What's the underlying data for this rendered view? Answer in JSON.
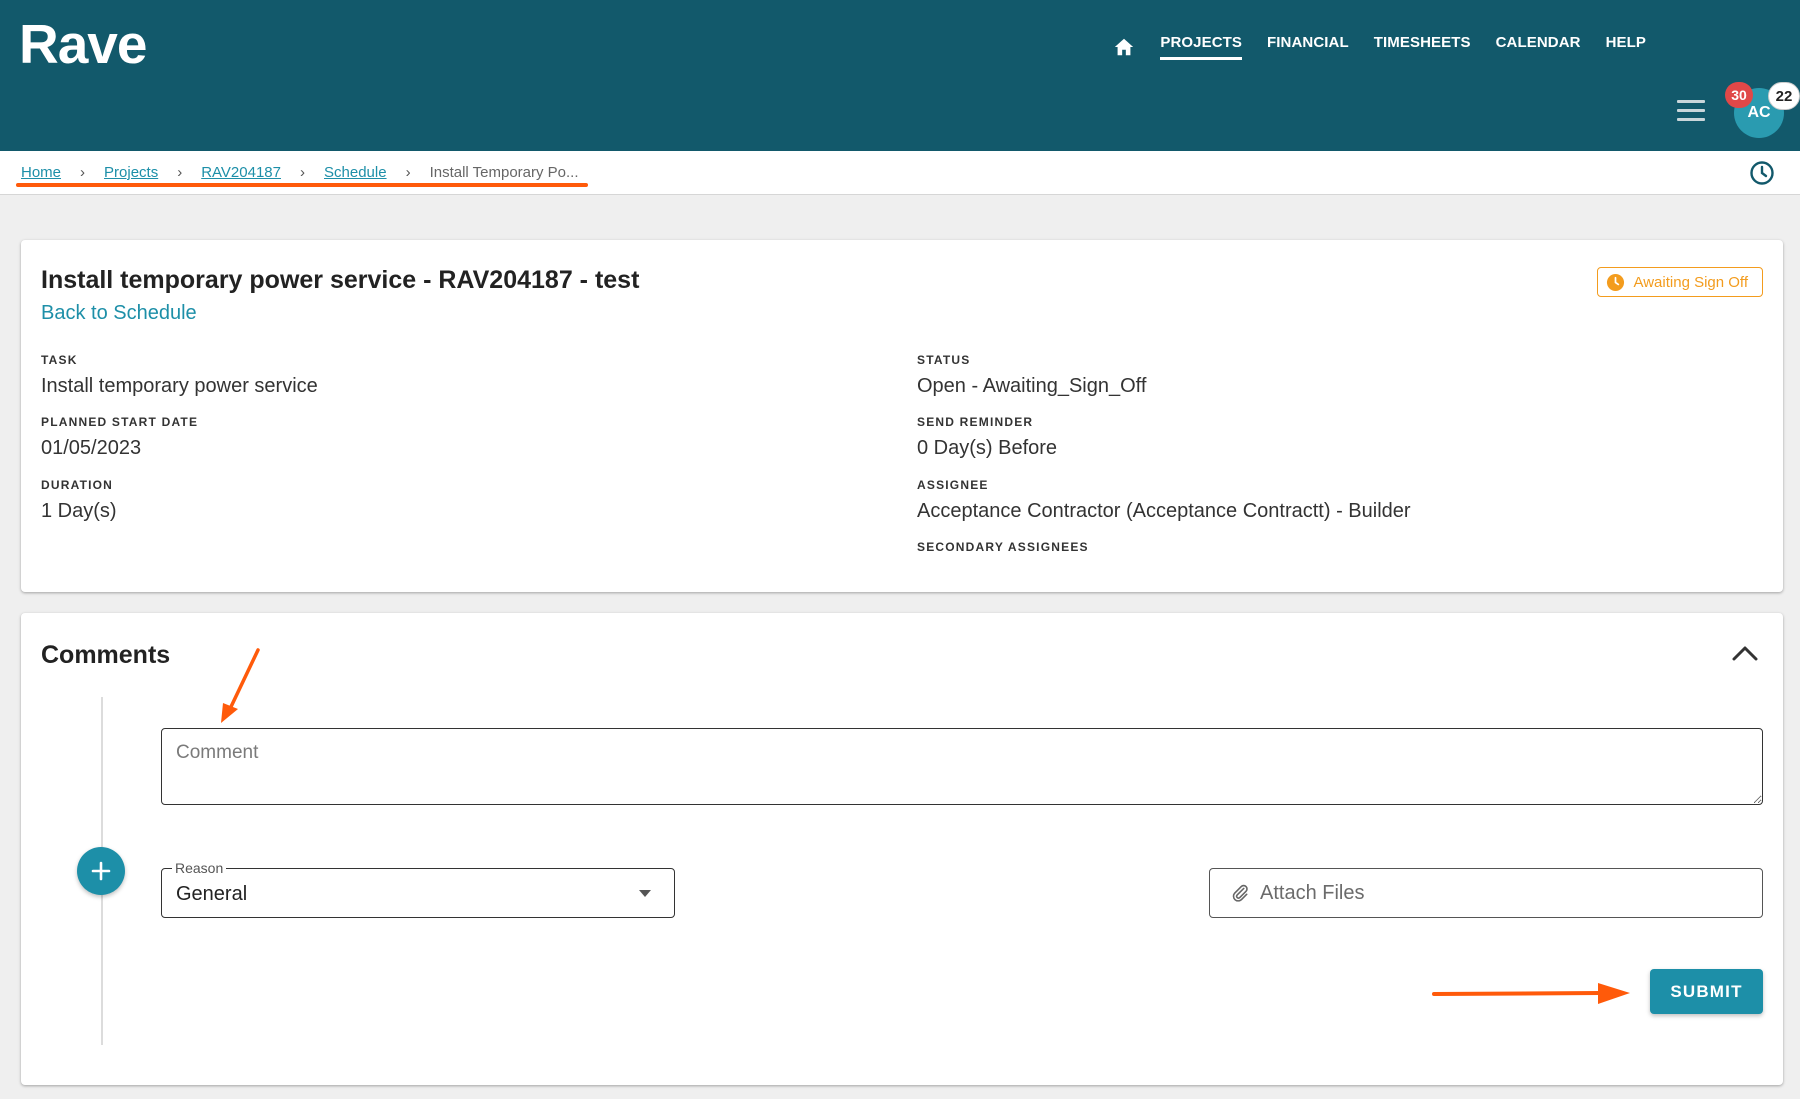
{
  "app": {
    "logo": "Rave",
    "accent_color": "#12596b",
    "link_color": "#1d8fa8",
    "annotation_color": "#ff5a0a"
  },
  "nav": {
    "home_icon": "home-icon",
    "items": [
      {
        "label": "PROJECTS",
        "active": true
      },
      {
        "label": "FINANCIAL",
        "active": false
      },
      {
        "label": "TIMESHEETS",
        "active": false
      },
      {
        "label": "CALENDAR",
        "active": false
      },
      {
        "label": "HELP",
        "active": false
      }
    ]
  },
  "user": {
    "initials": "AC",
    "notification_count": "30",
    "message_count": "22"
  },
  "breadcrumb": {
    "items": [
      "Home",
      "Projects",
      "RAV204187",
      "Schedule"
    ],
    "current": "Install Temporary Po..."
  },
  "task": {
    "title": "Install temporary power service - RAV204187 - test",
    "back_label": "Back to Schedule",
    "status_chip": "Awaiting Sign Off",
    "status_chip_color": "#f39c1e",
    "fields_left": [
      {
        "label": "TASK",
        "value": "Install temporary power service"
      },
      {
        "label": "PLANNED START DATE",
        "value": "01/05/2023"
      },
      {
        "label": "DURATION",
        "value": "1 Day(s)"
      }
    ],
    "fields_right": [
      {
        "label": "STATUS",
        "value": "Open - Awaiting_Sign_Off"
      },
      {
        "label": "SEND REMINDER",
        "value": "0 Day(s) Before"
      },
      {
        "label": "ASSIGNEE",
        "value": "Acceptance Contractor (Acceptance Contractt) - Builder"
      },
      {
        "label": "SECONDARY ASSIGNEES",
        "value": ""
      }
    ]
  },
  "comments": {
    "title": "Comments",
    "comment_placeholder": "Comment",
    "comment_value": "",
    "reason_label": "Reason",
    "reason_value": "General",
    "attach_label": "Attach Files",
    "submit_label": "SUBMIT"
  }
}
